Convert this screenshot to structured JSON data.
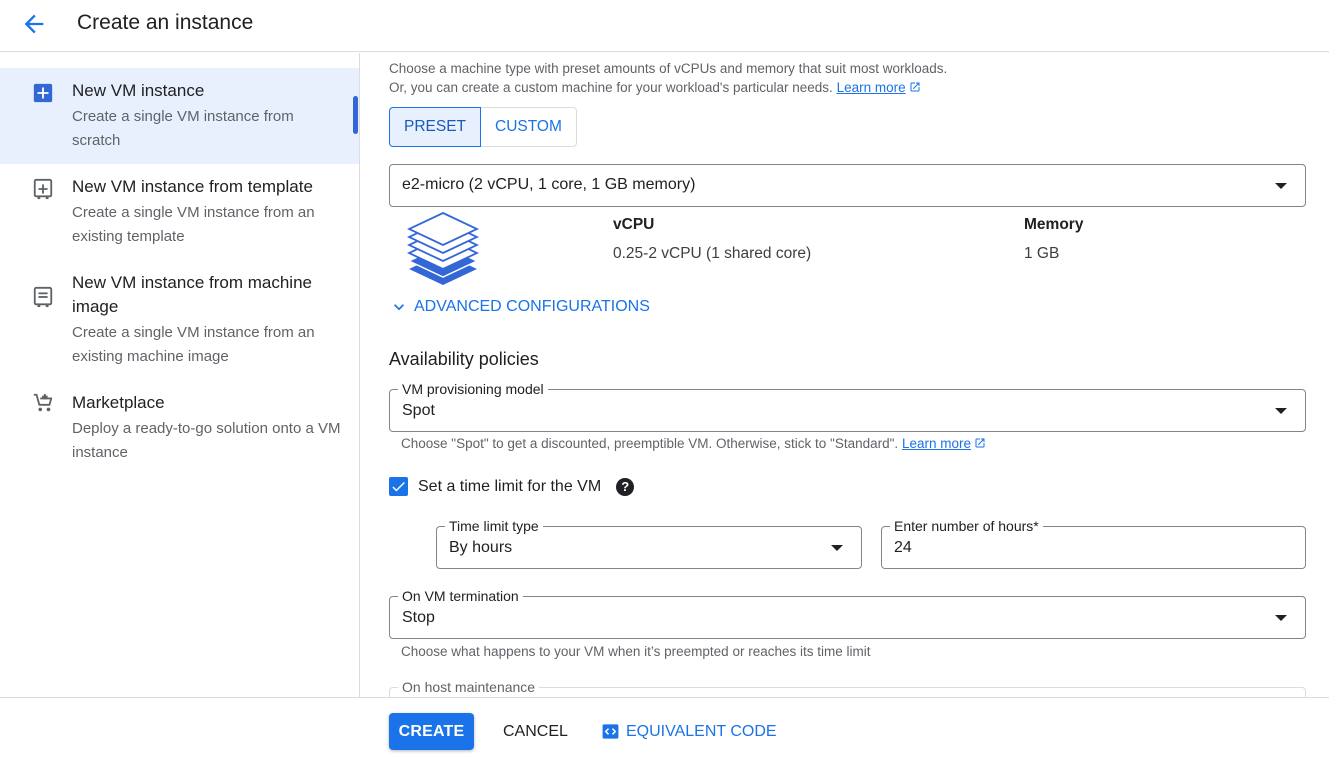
{
  "header": {
    "title": "Create an instance"
  },
  "sidebar": {
    "items": [
      {
        "title": "New VM instance",
        "desc": "Create a single VM instance from scratch"
      },
      {
        "title": "New VM instance from template",
        "desc": "Create a single VM instance from an existing template"
      },
      {
        "title": "New VM instance from machine image",
        "desc": "Create a single VM instance from an existing machine image"
      },
      {
        "title": "Marketplace",
        "desc": "Deploy a ready-to-go solution onto a VM instance"
      }
    ]
  },
  "machine": {
    "intro_line1": "Choose a machine type with preset amounts of vCPUs and memory that suit most workloads.",
    "intro_line2": "Or, you can create a custom machine for your workload's particular needs.",
    "learn_more": "Learn more",
    "preset_label": "PRESET",
    "custom_label": "CUSTOM",
    "selected_type": "e2-micro (2 vCPU, 1 core, 1 GB memory)",
    "vcpu_header": "vCPU",
    "vcpu_value": "0.25-2 vCPU (1 shared core)",
    "memory_header": "Memory",
    "memory_value": "1 GB",
    "advanced_label": "ADVANCED CONFIGURATIONS"
  },
  "availability": {
    "heading": "Availability policies",
    "provisioning_label": "VM provisioning model",
    "provisioning_value": "Spot",
    "provisioning_hint": "Choose \"Spot\" to get a discounted, preemptible VM. Otherwise, stick to \"Standard\".",
    "learn_more": "Learn more",
    "time_limit_label": "Set a time limit for the VM",
    "time_limit_checked": true,
    "time_limit_type_label": "Time limit type",
    "time_limit_type_value": "By hours",
    "hours_label": "Enter number of hours*",
    "hours_value": "24",
    "termination_label": "On VM termination",
    "termination_value": "Stop",
    "termination_hint": "Choose what happens to your VM when it’s preempted or reaches its time limit",
    "host_maintenance_label": "On host maintenance"
  },
  "footer": {
    "create_label": "CREATE",
    "cancel_label": "CANCEL",
    "code_label": "EQUIVALENT CODE"
  },
  "colors": {
    "accent": "#1a73e8",
    "active_bg": "#e8f0fe"
  }
}
